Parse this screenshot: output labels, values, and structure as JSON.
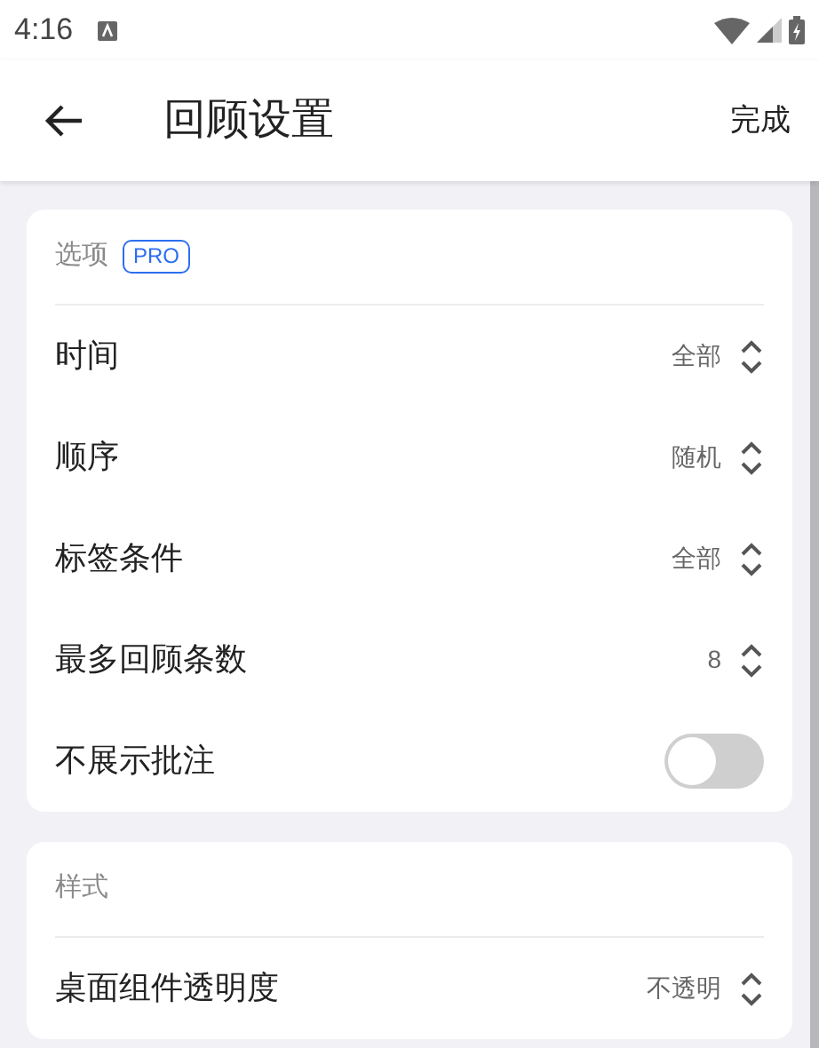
{
  "status_bar": {
    "time": "4:16"
  },
  "app_bar": {
    "title": "回顾设置",
    "action": "完成"
  },
  "sections": [
    {
      "title": "选项",
      "badge": "PRO",
      "rows": [
        {
          "kind": "select",
          "label": "时间",
          "value": "全部"
        },
        {
          "kind": "select",
          "label": "顺序",
          "value": "随机"
        },
        {
          "kind": "select",
          "label": "标签条件",
          "value": "全部"
        },
        {
          "kind": "select",
          "label": "最多回顾条数",
          "value": "8"
        },
        {
          "kind": "toggle",
          "label": "不展示批注",
          "on": false
        }
      ]
    },
    {
      "title": "样式",
      "rows": [
        {
          "kind": "select",
          "label": "桌面组件透明度",
          "value": "不透明"
        }
      ]
    }
  ]
}
